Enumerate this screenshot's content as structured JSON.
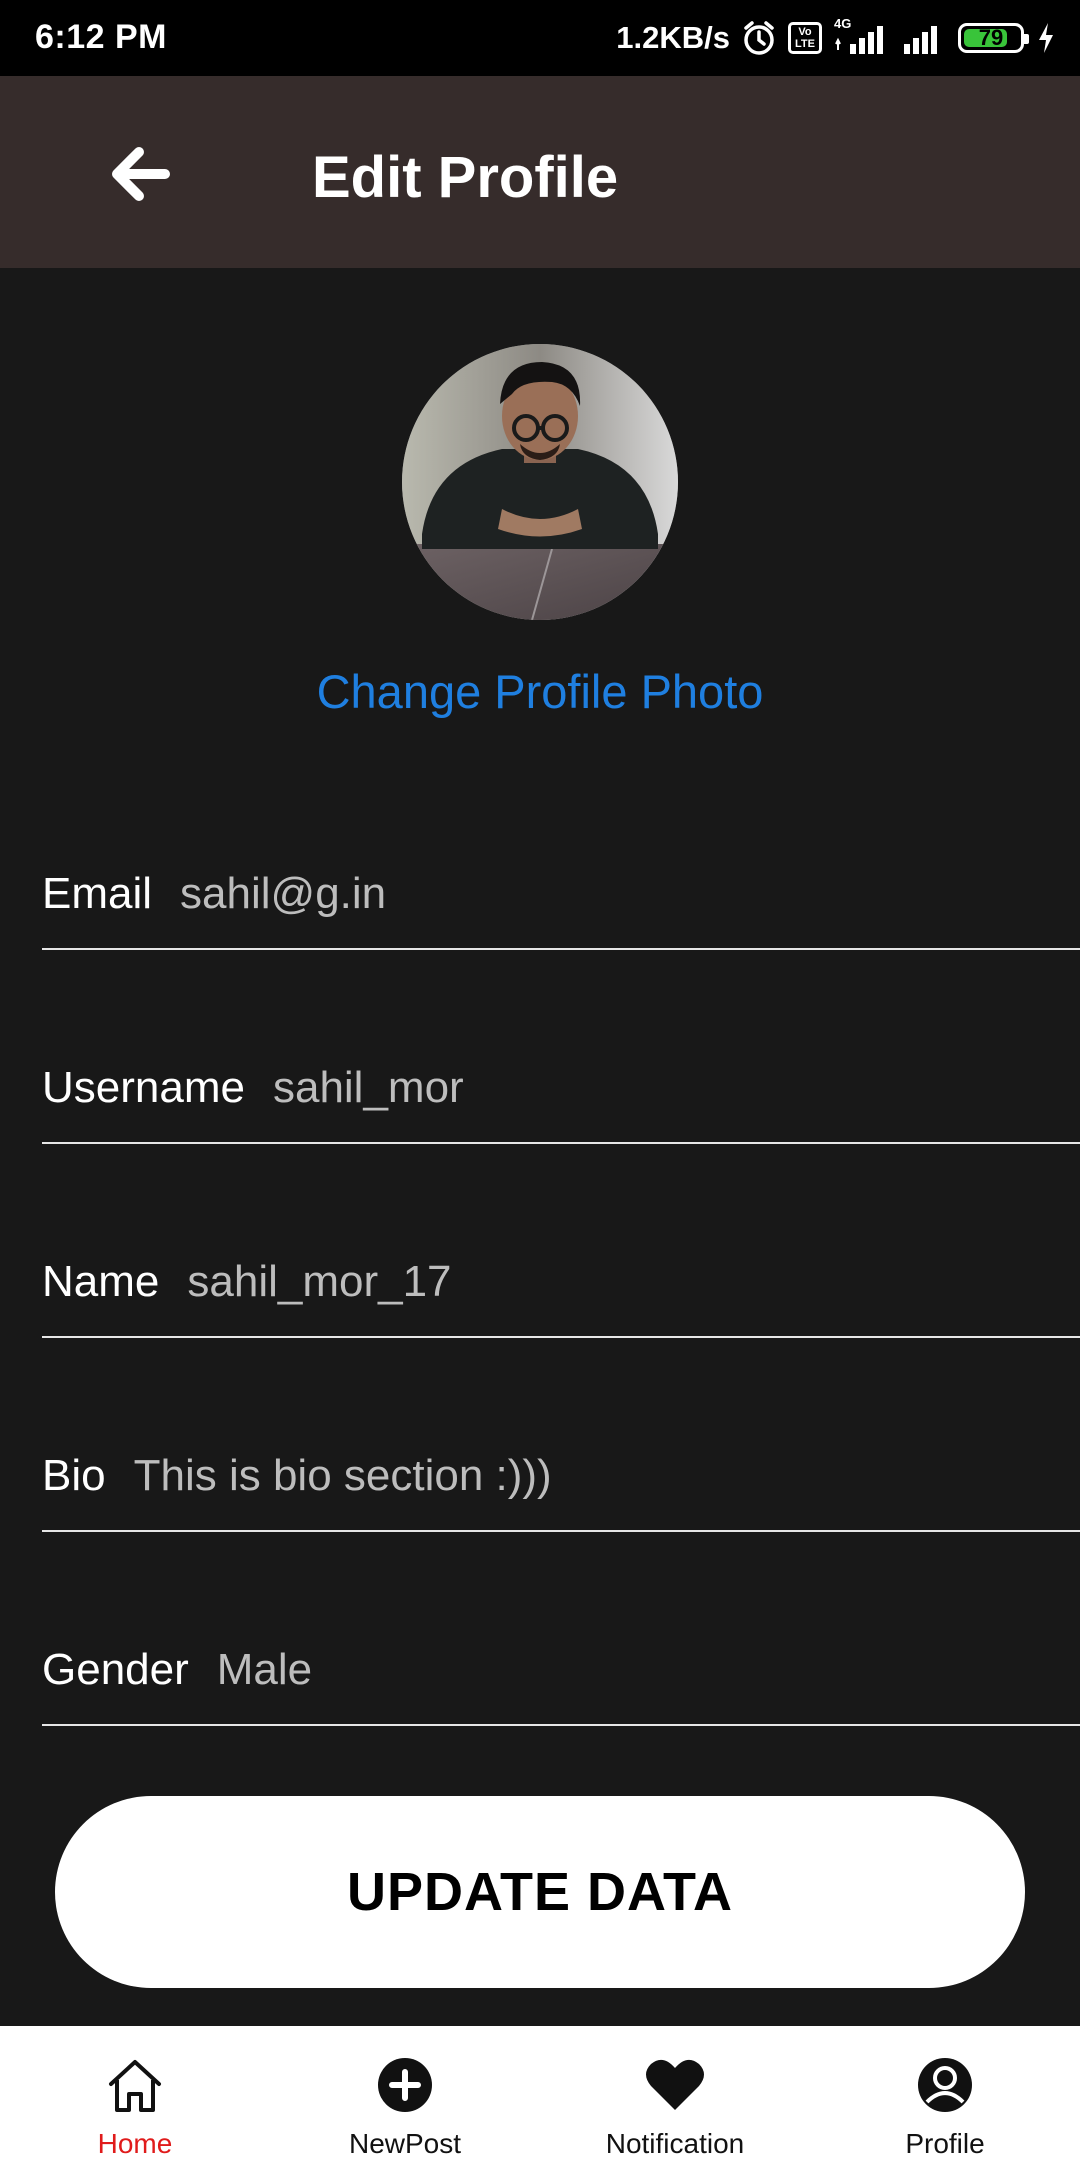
{
  "status_bar": {
    "time": "6:12 PM",
    "network_speed": "1.2KB/s",
    "volte_top": "Vo",
    "volte_bottom": "LTE",
    "network_type": "4G",
    "battery_level": "79",
    "battery_fraction": 0.79,
    "battery_color": "#39c43a"
  },
  "app_bar": {
    "title": "Edit Profile",
    "background": "#362c2b"
  },
  "profile": {
    "change_photo_label": "Change Profile Photo",
    "link_color": "#1f7fe0"
  },
  "fields": [
    {
      "label": "Email",
      "value": "sahil@g.in"
    },
    {
      "label": "Username",
      "value": "sahil_mor"
    },
    {
      "label": "Name",
      "value": "sahil_mor_17"
    },
    {
      "label": "Bio",
      "value": "This is bio section :)))"
    },
    {
      "label": "Gender",
      "value": "Male"
    }
  ],
  "update_button": {
    "label": "UPDATE DATA"
  },
  "bottom_nav": {
    "items": [
      {
        "label": "Home",
        "icon": "home-icon",
        "active": true
      },
      {
        "label": "NewPost",
        "icon": "add-circle-icon",
        "active": false
      },
      {
        "label": "Notification",
        "icon": "heart-icon",
        "active": false
      },
      {
        "label": "Profile",
        "icon": "profile-icon",
        "active": false
      }
    ],
    "active_color": "#e01b1b"
  }
}
